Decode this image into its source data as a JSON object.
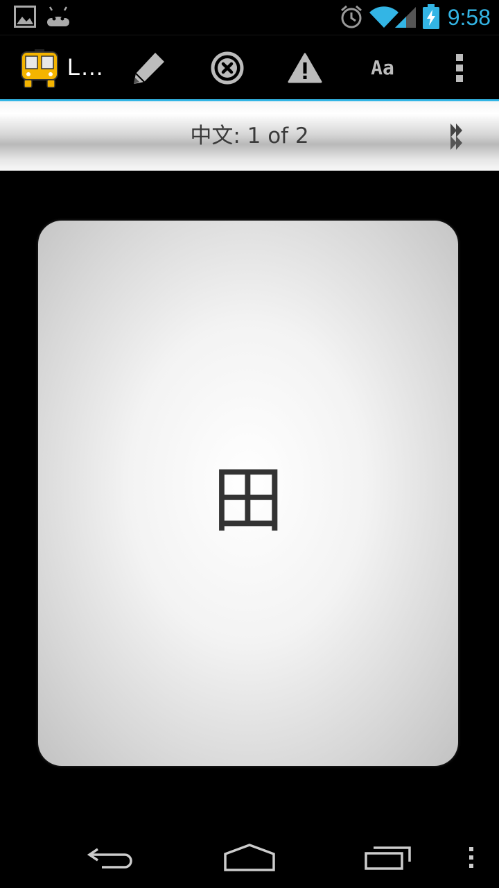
{
  "status_bar": {
    "time": "9:58",
    "notification_icons": [
      "gallery-icon",
      "android-icon"
    ],
    "system_icons": [
      "alarm-icon",
      "wifi-icon",
      "signal-icon",
      "battery-charging-icon"
    ],
    "accent_color": "#33b5e5"
  },
  "action_bar": {
    "app_icon": "bus-icon",
    "title": "L…",
    "actions": [
      {
        "icon": "pencil-icon",
        "name": "edit"
      },
      {
        "icon": "close-circle-icon",
        "name": "delete"
      },
      {
        "icon": "warning-icon",
        "name": "report"
      },
      {
        "icon": "font-size-icon",
        "label": "Aa"
      },
      {
        "icon": "overflow-menu-icon",
        "name": "more"
      }
    ]
  },
  "pager": {
    "label": "中文: 1 of 2",
    "next_icon": "fast-forward-icon"
  },
  "card": {
    "character": "田"
  },
  "navigation_bar": {
    "buttons": [
      "back-icon",
      "home-icon",
      "recent-apps-icon",
      "overflow-menu-icon"
    ]
  }
}
